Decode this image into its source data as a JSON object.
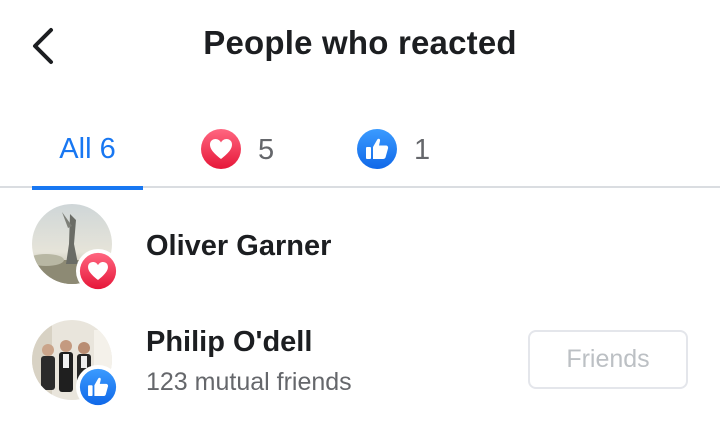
{
  "header": {
    "title": "People who reacted",
    "back_icon": "chevron-left-icon"
  },
  "tabs": [
    {
      "label": "All 6",
      "active": true
    },
    {
      "icon": "love-reaction-icon",
      "count": "5"
    },
    {
      "icon": "like-reaction-icon",
      "count": "1"
    }
  ],
  "colors": {
    "accent": "#1877f2",
    "love": "#f33e58",
    "muted_text": "#65676b",
    "divider": "#dadde1"
  },
  "people": [
    {
      "name": "Oliver Garner",
      "reaction": "love-reaction-icon",
      "avatar": "profile-photo"
    },
    {
      "name": "Philip O'dell",
      "subtext": "123 mutual friends",
      "reaction": "like-reaction-icon",
      "avatar": "profile-photo",
      "button_label": "Friends"
    }
  ]
}
